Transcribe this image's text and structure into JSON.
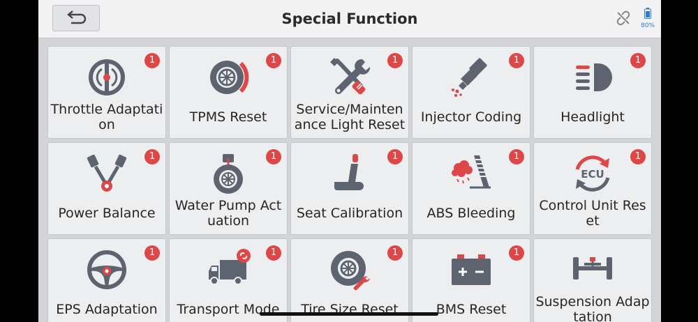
{
  "header": {
    "title": "Special Function",
    "back_icon": "back-arrow-icon",
    "link_icon": "unlinked-icon",
    "battery_icon": "battery-icon",
    "battery_level": "80%"
  },
  "colors": {
    "accent_red": "#de4748",
    "icon_gray": "#5d6470",
    "battery_blue": "#2a7fd4"
  },
  "tiles": [
    {
      "label": "Throttle Adaptation",
      "badge": "1",
      "icon": "throttle-icon"
    },
    {
      "label": "TPMS Reset",
      "badge": "1",
      "icon": "tpms-tire-icon"
    },
    {
      "label": "Service/Maintenance Light Reset",
      "badge": "1",
      "icon": "wrench-screwdriver-icon"
    },
    {
      "label": "Injector Coding",
      "badge": "1",
      "icon": "injector-icon"
    },
    {
      "label": "Headlight",
      "badge": "1",
      "icon": "headlight-icon"
    },
    {
      "label": "Power Balance",
      "badge": "1",
      "icon": "engine-cylinders-icon"
    },
    {
      "label": "Water Pump Actuation",
      "badge": "1",
      "icon": "water-pump-icon"
    },
    {
      "label": "Seat Calibration",
      "badge": "1",
      "icon": "seat-icon"
    },
    {
      "label": "ABS Bleeding",
      "badge": "1",
      "icon": "abs-brake-icon"
    },
    {
      "label": "Control Unit Reset",
      "badge": "1",
      "icon": "ecu-reset-icon"
    },
    {
      "label": "EPS Adaptation",
      "badge": "1",
      "icon": "steering-wheel-icon"
    },
    {
      "label": "Transport Mode",
      "badge": "1",
      "icon": "truck-icon"
    },
    {
      "label": "Tire Size Reset",
      "badge": "1",
      "icon": "tire-wrench-icon"
    },
    {
      "label": "BMS Reset",
      "badge": "1",
      "icon": "battery-bms-icon"
    },
    {
      "label": "Suspension Adaptation",
      "badge": "",
      "icon": "suspension-axle-icon"
    }
  ]
}
